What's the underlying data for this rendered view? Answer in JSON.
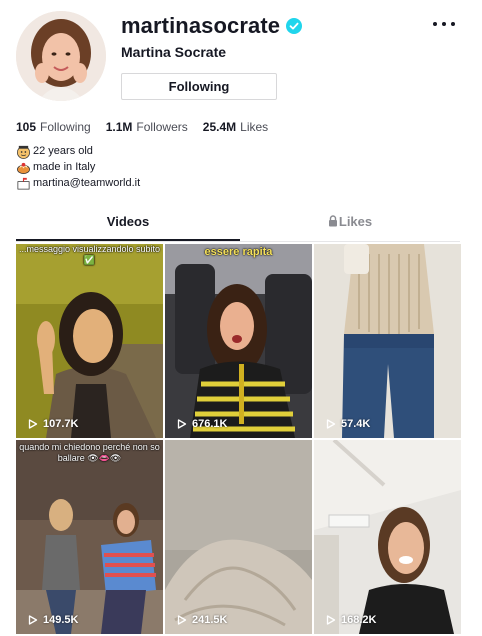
{
  "profile": {
    "username": "martinasocrate",
    "nickname": "Martina Socrate",
    "follow_label": "Following",
    "stats": {
      "following_count": "105",
      "following_label": "Following",
      "followers_count": "1.1M",
      "followers_label": "Followers",
      "likes_count": "25.4M",
      "likes_label": "Likes"
    },
    "bio": [
      {
        "icon": "face-icon",
        "text": "22 years old"
      },
      {
        "icon": "pasta-icon",
        "text": "made in Italy"
      },
      {
        "icon": "mailbox-icon",
        "text": "martina@teamworld.it"
      }
    ]
  },
  "tabs": [
    {
      "label": "Videos",
      "active": true
    },
    {
      "label": "Likes",
      "active": false,
      "locked": true
    }
  ],
  "videos": [
    {
      "views": "107.7K",
      "caption": "...messaggio visualizzandolo subito ✅"
    },
    {
      "views": "676.1K",
      "caption": "essere rapita"
    },
    {
      "views": "57.4K",
      "caption": ""
    },
    {
      "views": "149.5K",
      "caption": "quando mi chiedono perché non so ballare 👁👄👁"
    },
    {
      "views": "241.5K",
      "caption": ""
    },
    {
      "views": "168.2K",
      "caption": ""
    }
  ],
  "colors": {
    "verified": "#20d5ec",
    "text_primary": "#161823",
    "text_secondary": "#8a8b91"
  }
}
